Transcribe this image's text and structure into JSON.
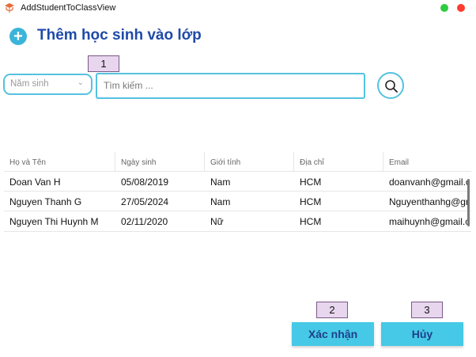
{
  "window": {
    "title": "AddStudentToClassView"
  },
  "header": {
    "title": "Thêm học sinh vào lớp"
  },
  "markers": [
    "1",
    "2",
    "3"
  ],
  "filters": {
    "year_placeholder": "Năm sinh",
    "search_placeholder": "Tìm kiếm ..."
  },
  "table": {
    "columns": [
      "Họ và Tên",
      "Ngày sinh",
      "Giới tính",
      "Địa chỉ",
      "Email"
    ],
    "rows": [
      [
        "Doan Van H",
        "05/08/2019",
        "Nam",
        "HCM",
        "doanvanh@gmail.c"
      ],
      [
        "Nguyen Thanh G",
        "27/05/2024",
        "Nam",
        "HCM",
        "Nguyenthanhg@gn"
      ],
      [
        "Nguyen Thi Huynh M",
        "02/11/2020",
        "Nữ",
        "HCM",
        "maihuynh@gmail.c"
      ]
    ]
  },
  "actions": {
    "confirm_label": "Xác nhận",
    "cancel_label": "Hủy"
  },
  "colors": {
    "accent": "#45c9e6",
    "border": "#55c2e0",
    "title": "#1f4aa8",
    "marker_bg": "#e8d6ee"
  },
  "icons": [
    "app-icon",
    "plus-icon",
    "chevron-down-icon",
    "search-icon"
  ]
}
